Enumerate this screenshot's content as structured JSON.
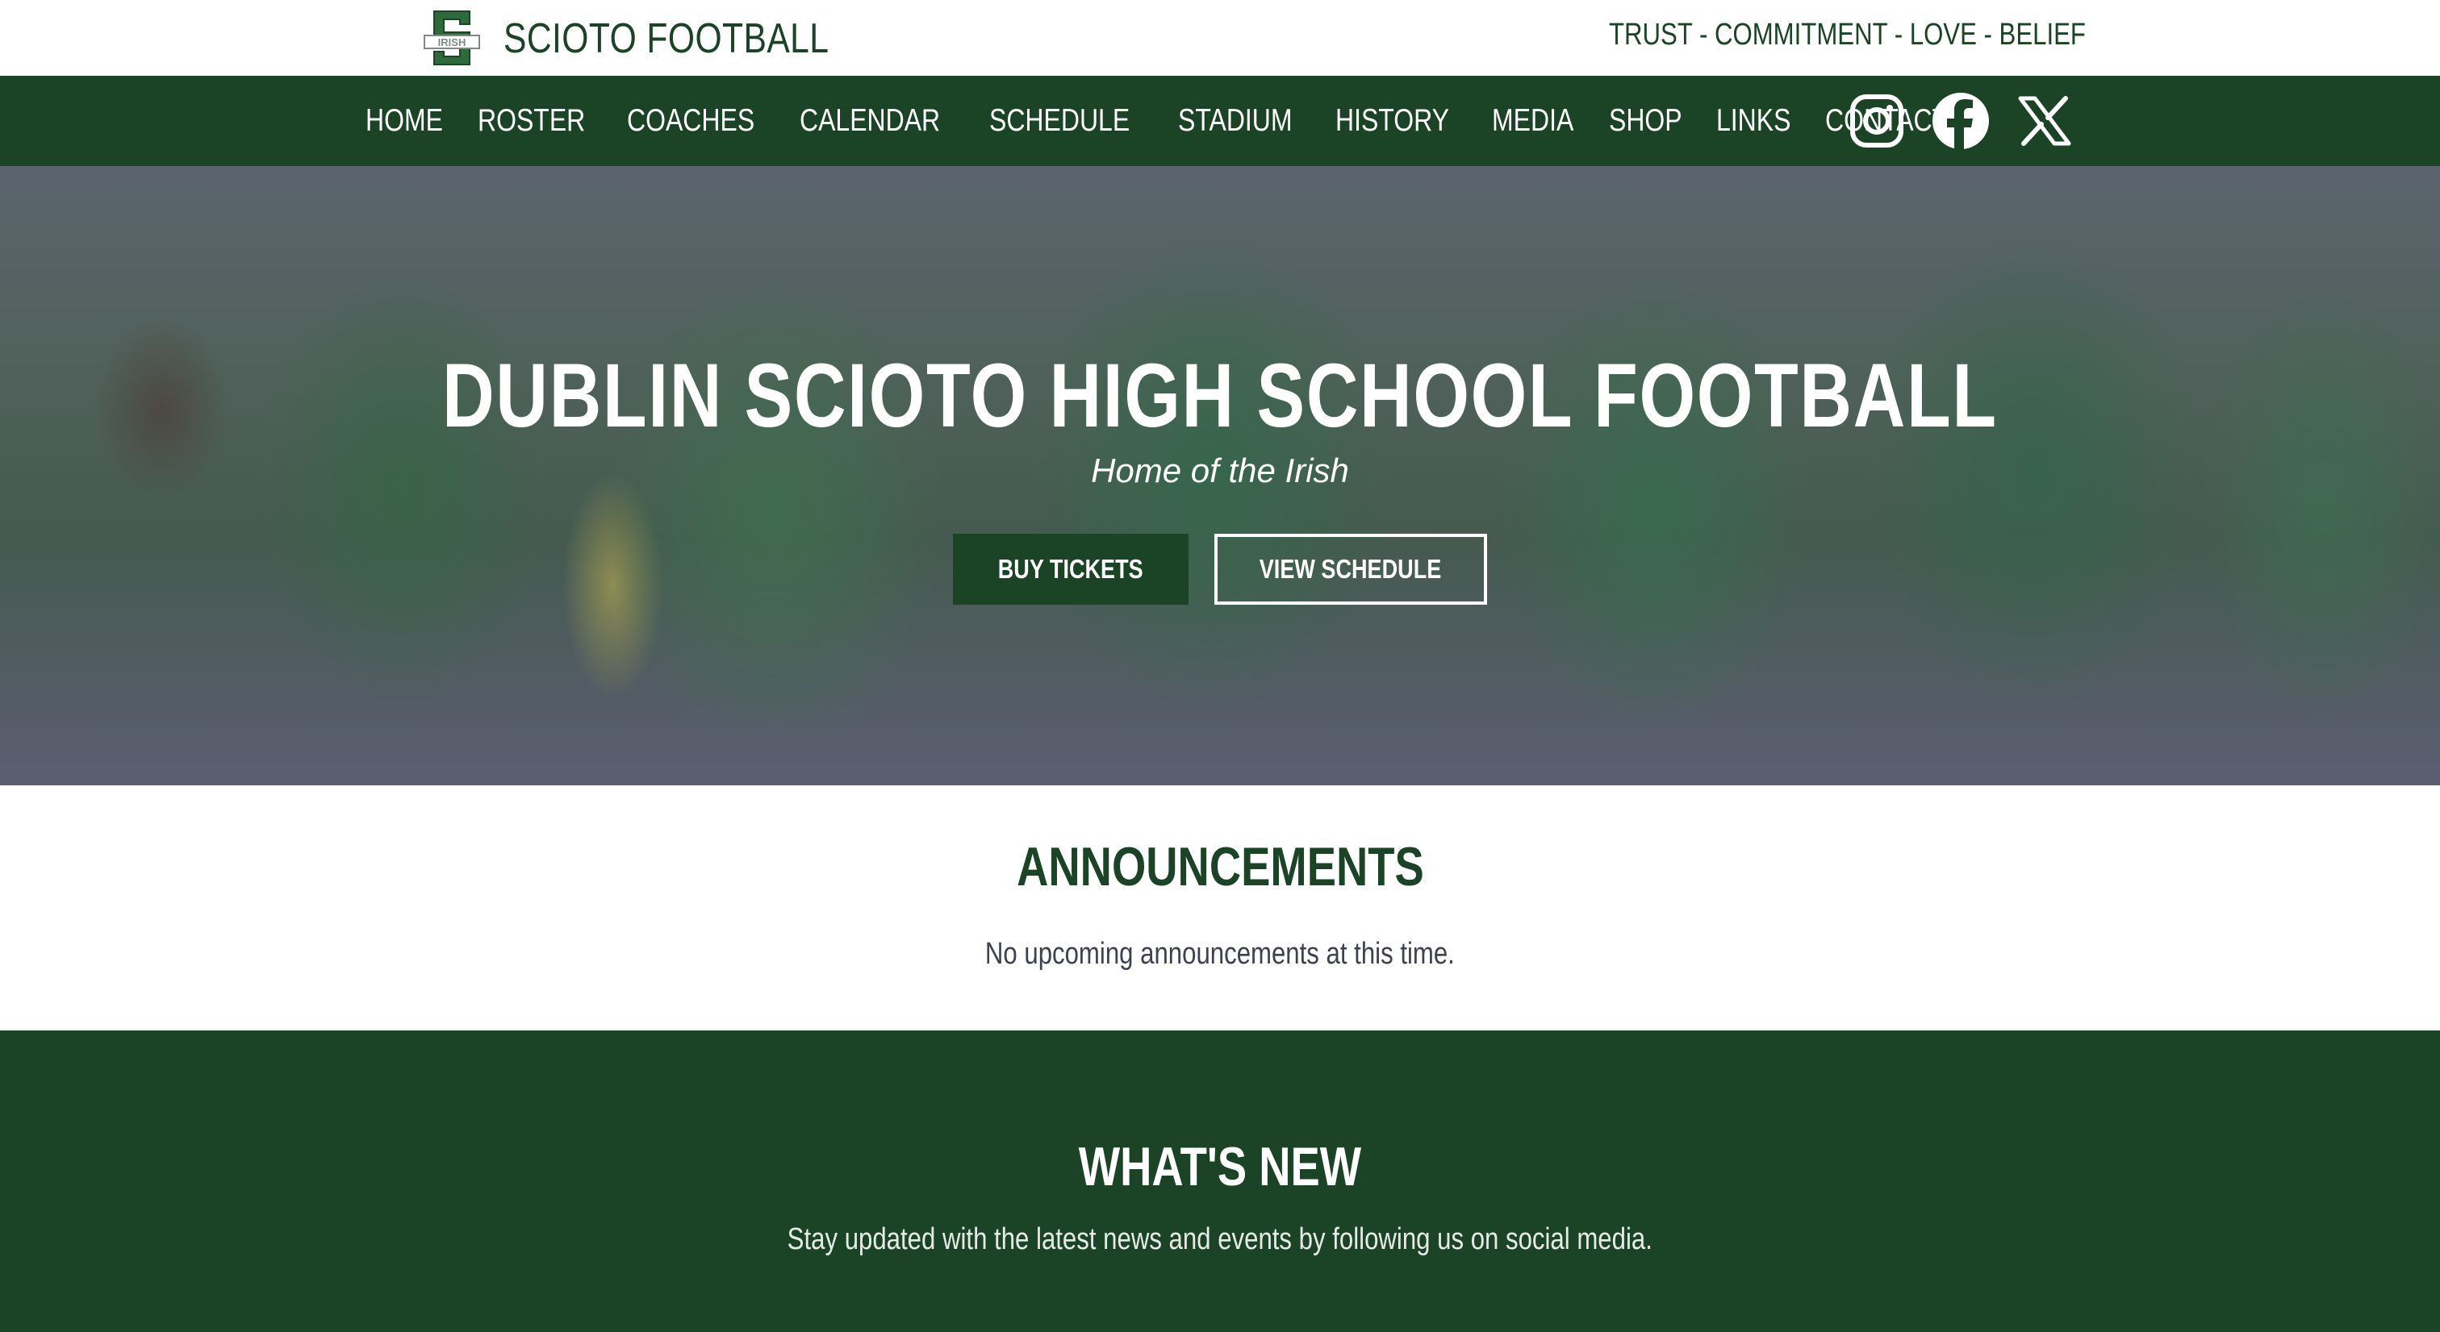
{
  "brand": {
    "name": "SCIOTO FOOTBALL",
    "logo_text": "IRISH",
    "motto": "TRUST - COMMITMENT - LOVE - BELIEF"
  },
  "nav": {
    "items": [
      {
        "label": "HOME"
      },
      {
        "label": "ROSTER"
      },
      {
        "label": "COACHES"
      },
      {
        "label": "CALENDAR"
      },
      {
        "label": "SCHEDULE"
      },
      {
        "label": "STADIUM"
      },
      {
        "label": "HISTORY"
      },
      {
        "label": "MEDIA"
      },
      {
        "label": "SHOP"
      },
      {
        "label": "LINKS"
      },
      {
        "label": "CONTACT"
      }
    ],
    "social": [
      "instagram-icon",
      "facebook-icon",
      "x-icon"
    ]
  },
  "hero": {
    "title": "DUBLIN SCIOTO HIGH SCHOOL FOOTBALL",
    "subtitle": "Home of the Irish",
    "primary_button": "BUY TICKETS",
    "secondary_button": "VIEW SCHEDULE"
  },
  "announcements": {
    "title": "ANNOUNCEMENTS",
    "text": "No upcoming announcements at this time."
  },
  "whats_new": {
    "title": "WHAT'S NEW",
    "text": "Stay updated with the latest news and events by following us on social media."
  },
  "colors": {
    "brand_green": "#1b4326",
    "white": "#ffffff",
    "body_text": "#3d4250"
  }
}
